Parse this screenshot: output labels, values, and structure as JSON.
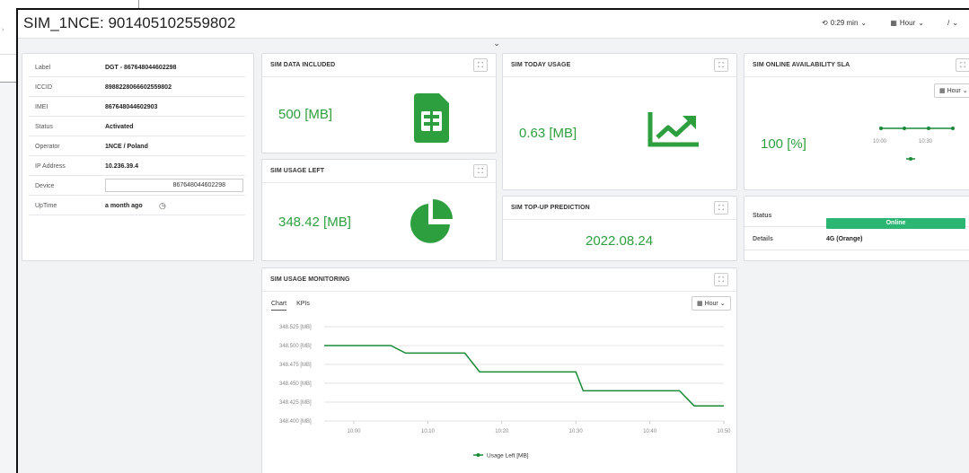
{
  "header": {
    "title": "SIM_1NCE: 901405102559802",
    "refresh": "0:29 min",
    "interval": "Hour",
    "more": "/"
  },
  "info": {
    "rows": [
      {
        "label": "Label",
        "value": "DGT - 867648044602298"
      },
      {
        "label": "ICCID",
        "value": "8988228066602559802"
      },
      {
        "label": "IMEI",
        "value": "867648044602903"
      },
      {
        "label": "Status",
        "value": "Activated"
      },
      {
        "label": "Operator",
        "value": "1NCE / Poland"
      },
      {
        "label": "IP Address",
        "value": "10.236.39.4"
      },
      {
        "label": "Device",
        "value": "867648044602298"
      },
      {
        "label": "UpTime",
        "value": "a month ago"
      }
    ]
  },
  "cards": {
    "data_included": {
      "title": "SIM DATA INCLUDED",
      "value": "500 [MB]"
    },
    "today_usage": {
      "title": "SIM TODAY USAGE",
      "value": "0.63 [MB]"
    },
    "sla": {
      "title": "SIM ONLINE AVAILABILITY SLA",
      "value": "100 [%]",
      "interval": "Hour",
      "ticks": [
        "10:00",
        "10:30"
      ]
    },
    "usage_left": {
      "title": "SIM USAGE LEFT",
      "value": "348.42 [MB]"
    },
    "topup": {
      "title": "SIM TOP-UP PREDICTION",
      "value": "2022.08.24"
    },
    "status": {
      "status_label": "Status",
      "status_value": "Online",
      "details_label": "Details",
      "details_value": "4G (Orange)"
    },
    "monitoring": {
      "title": "SIM USAGE MONITORING",
      "tab_chart": "Chart",
      "tab_kpis": "KPIs",
      "interval": "Hour"
    }
  },
  "colors": {
    "accent": "#2e9f3e",
    "online": "#2bb673",
    "line": "#1a8a36"
  },
  "chart_data": {
    "type": "line",
    "title": "",
    "xlabel": "",
    "ylabel": "",
    "x_ticks": [
      "10:00",
      "10:10",
      "10:20",
      "10:30",
      "10:40",
      "10:50"
    ],
    "y_ticks": [
      "348.525 [MB]",
      "348.500 [MB]",
      "348.475 [MB]",
      "348.450 [MB]",
      "348.425 [MB]",
      "348.400 [MB]"
    ],
    "ylim": [
      348.4,
      348.525
    ],
    "series": [
      {
        "name": "Usage Left [MB]",
        "x": [
          "09:56",
          "10:00",
          "10:05",
          "10:07",
          "10:10",
          "10:15",
          "10:17",
          "10:20",
          "10:25",
          "10:30",
          "10:31",
          "10:35",
          "10:40",
          "10:44",
          "10:46",
          "10:49",
          "10:50"
        ],
        "values": [
          348.5,
          348.5,
          348.5,
          348.49,
          348.49,
          348.49,
          348.465,
          348.465,
          348.465,
          348.465,
          348.44,
          348.44,
          348.44,
          348.44,
          348.42,
          348.42,
          348.42
        ]
      }
    ],
    "grid": true,
    "legend": "bottom"
  }
}
